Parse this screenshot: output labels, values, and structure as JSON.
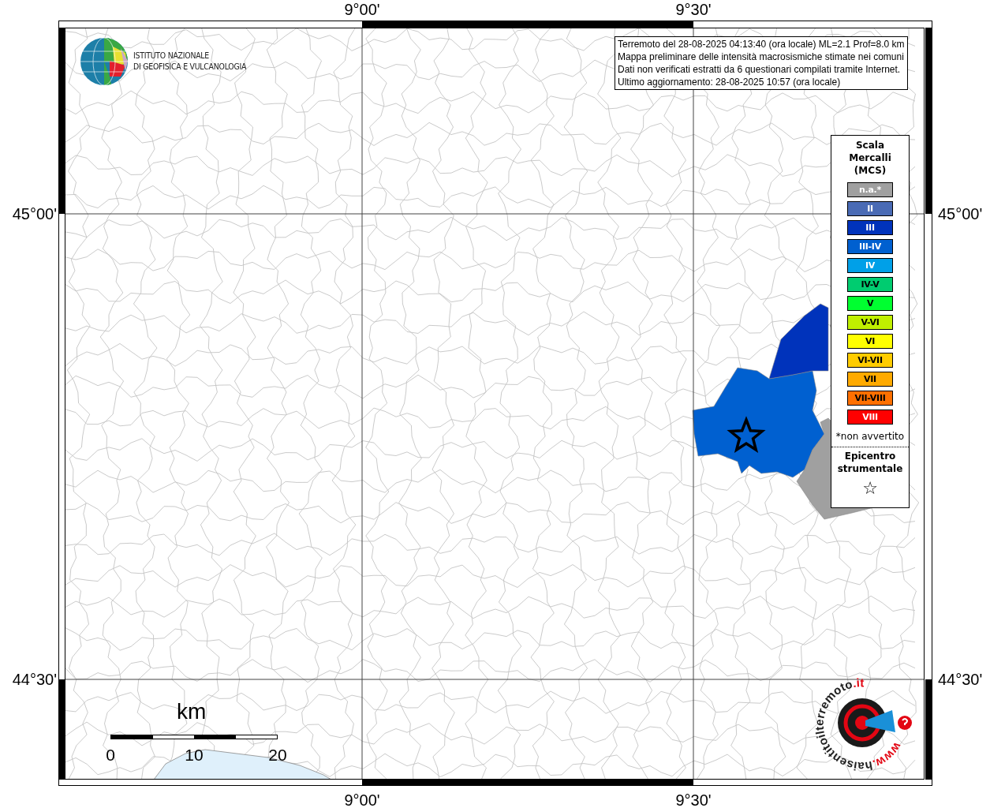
{
  "axes": {
    "top": [
      "9°00'",
      "9°30'"
    ],
    "bottom": [
      "9°00'",
      "9°30'"
    ],
    "left": [
      "45°00'",
      "44°30'"
    ],
    "right": [
      "45°00'",
      "44°30'"
    ]
  },
  "institute_logo": {
    "lines": [
      "ISTITUTO NAZIONALE",
      "DI GEOFISICA E VULCANOLOGIA"
    ]
  },
  "info_box": [
    "Terremoto del 28-08-2025 04:13:40 (ora locale) ML=2.1 Prof=8.0 km",
    "Mappa preliminare delle intensità macrosismiche stimate nei comuni",
    "Dati non verificati estratti da 6 questionari compilati tramite Internet.",
    "Ultimo aggiornamento: 28-08-2025 10:57 (ora locale)"
  ],
  "intensity_areas": [
    {
      "color": "#0060d0"
    },
    {
      "color": "#0033bb"
    },
    {
      "color": "#a0a0a0"
    }
  ],
  "legend": {
    "title": [
      "Scala",
      "Mercalli",
      "(MCS)"
    ],
    "items": [
      {
        "label": "n.a.*",
        "color": "#a0a0a0"
      },
      {
        "label": "II",
        "color": "#4a6bb5"
      },
      {
        "label": "III",
        "color": "#0033bb"
      },
      {
        "label": "III-IV",
        "color": "#0060d0"
      },
      {
        "label": "IV",
        "color": "#00a0e8"
      },
      {
        "label": "IV-V",
        "color": "#00cc70"
      },
      {
        "label": "V",
        "color": "#00ff30"
      },
      {
        "label": "V-VI",
        "color": "#c0f000"
      },
      {
        "label": "VI",
        "color": "#ffff00"
      },
      {
        "label": "VI-VII",
        "color": "#ffcc00"
      },
      {
        "label": "VII",
        "color": "#ffaa00"
      },
      {
        "label": "VII-VIII",
        "color": "#ff7000"
      },
      {
        "label": "VIII",
        "color": "#ff0000"
      }
    ],
    "note": "*non avvertito",
    "epicenter_title": [
      "Epicentro",
      "strumentale"
    ],
    "epicenter_symbol": "☆"
  },
  "scale_bar": {
    "unit": "km",
    "labels": [
      "0",
      "10",
      "20"
    ]
  },
  "site_logo": [
    {
      "text": "www.",
      "color": "#e30613"
    },
    {
      "text": "haisentitoilterremoto",
      "color": "#222222"
    },
    {
      "text": ".it",
      "color": "#e30613"
    }
  ]
}
